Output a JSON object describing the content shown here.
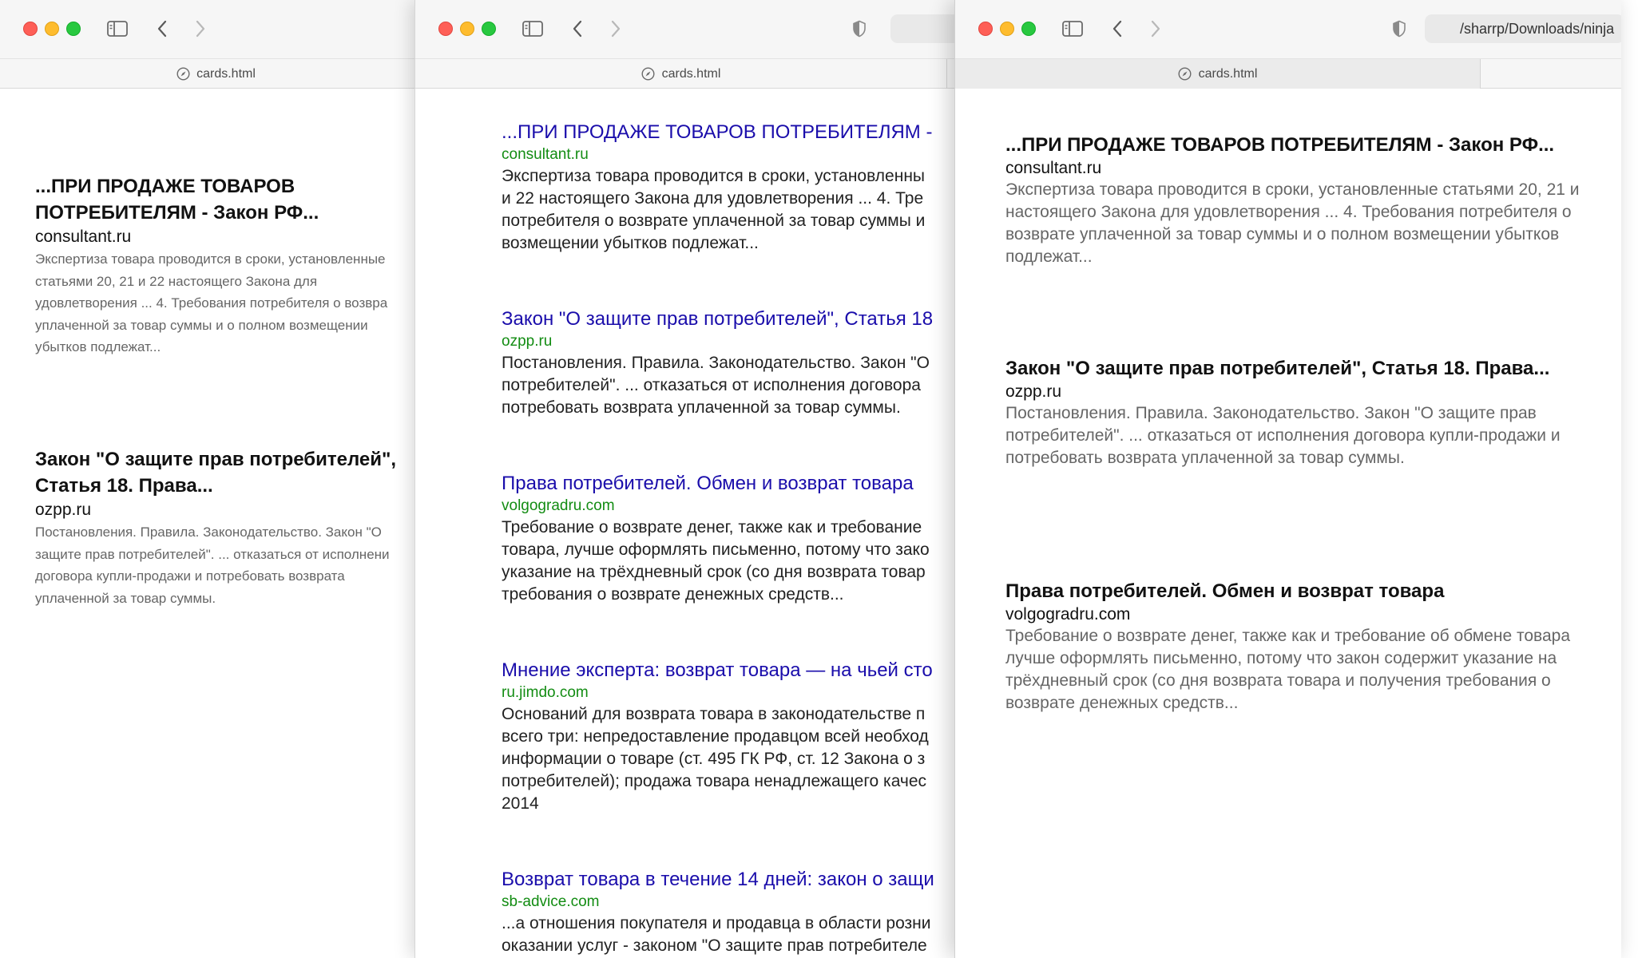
{
  "windows": [
    {
      "tab_label": "cards.html",
      "address": "",
      "cards": [
        {
          "title_lines": [
            "...ПРИ ПРОДАЖЕ ТОВАРОВ",
            "ПОТРЕБИТЕЛЯМ - Закон РФ..."
          ],
          "domain": "consultant.ru",
          "snippet_lines": [
            "Экспертиза товара проводится в сроки, установленные",
            "статьями 20, 21 и 22 настоящего Закона для",
            "удовлетворения ... 4. Требования потребителя о возвра",
            "уплаченной за товар суммы и о полном возмещении",
            "убытков подлежат..."
          ]
        },
        {
          "title_lines": [
            "Закон \"О защите прав потребителей\",",
            "Статья 18. Права..."
          ],
          "domain": "ozpp.ru",
          "snippet_lines": [
            "Постановления. Правила. Законодательство. Закон \"О",
            "защите прав потребителей\". ... отказаться от исполнени",
            "договора купли-продажи и потребовать возврата",
            "уплаченной за товар суммы."
          ]
        }
      ]
    },
    {
      "tab_label": "cards.html",
      "address": "",
      "cards": [
        {
          "title_lines": [
            "...ПРИ ПРОДАЖЕ ТОВАРОВ ПОТРЕБИТЕЛЯМ -"
          ],
          "domain": "consultant.ru",
          "snippet_lines": [
            "Экспертиза товара проводится в сроки, установленны",
            "и 22 настоящего Закона для удовлетворения ... 4. Тре",
            "потребителя о возврате уплаченной за товар суммы и",
            "возмещении убытков подлежат..."
          ]
        },
        {
          "title_lines": [
            "Закон \"О защите прав потребителей\", Статья 18"
          ],
          "domain": "ozpp.ru",
          "snippet_lines": [
            "Постановления. Правила. Законодательство. Закон \"О",
            "потребителей\". ... отказаться от исполнения договора",
            "потребовать возврата уплаченной за товар суммы."
          ]
        },
        {
          "title_lines": [
            "Права потребителей. Обмен и возврат товара"
          ],
          "domain": "volgogradru.com",
          "snippet_lines": [
            "Требование о возврате денег, также как и требование",
            "товара, лучше оформлять письменно, потому что зако",
            "указание на трёхдневный срок (со дня возврата товар",
            "требования о возврате денежных средств..."
          ]
        },
        {
          "title_lines": [
            "Мнение эксперта: возврат товара — на чьей сто"
          ],
          "domain": "ru.jimdo.com",
          "snippet_lines": [
            "Оснований для возврата товара в законодательстве п",
            "всего три: непредоставление продавцом всей необход",
            "информации о товаре (ст. 495 ГК РФ, ст. 12 Закона о з",
            "потребителей); продажа товара ненадлежащего качес",
            "2014"
          ]
        },
        {
          "title_lines": [
            "Возврат товара в течение 14 дней: закон о защи"
          ],
          "domain": "sb-advice.com",
          "snippet_lines": [
            "...а отношения покупателя и продавца в области розни",
            "оказании услуг - законом \"О защите прав потребителе"
          ]
        }
      ]
    },
    {
      "tab_label": "cards.html",
      "address": "/sharrp/Downloads/ninja",
      "cards": [
        {
          "title_lines": [
            "...ПРИ ПРОДАЖЕ ТОВАРОВ ПОТРЕБИТЕЛЯМ - Закон РФ..."
          ],
          "domain": "consultant.ru",
          "snippet_lines": [
            "Экспертиза товара проводится в сроки, установленные статьями 20, 21 и",
            "настоящего Закона для удовлетворения ... 4. Требования потребителя о",
            "возврате уплаченной за товар суммы и о полном возмещении убытков",
            "подлежат..."
          ]
        },
        {
          "title_lines": [
            "Закон \"О защите прав потребителей\", Статья 18. Права..."
          ],
          "domain": "ozpp.ru",
          "snippet_lines": [
            "Постановления. Правила. Законодательство. Закон \"О защите прав",
            "потребителей\". ... отказаться от исполнения договора купли-продажи и",
            "потребовать возврата уплаченной за товар суммы."
          ]
        },
        {
          "title_lines": [
            "Права потребителей. Обмен и возврат товара"
          ],
          "domain": "volgogradru.com",
          "snippet_lines": [
            "Требование о возврате денег, также как и требование об обмене товара",
            "лучше оформлять письменно, потому что закон содержит указание на",
            "трёхдневный срок (со дня возврата товара и получения требования о",
            "возврате денежных средств..."
          ]
        }
      ]
    }
  ],
  "colors": {
    "close": "#fe5f57",
    "minimize": "#febc2e",
    "zoom": "#28c840",
    "link_blue": "#1a0dab",
    "domain_green": "#128c12"
  },
  "icons": {
    "sidebar": "sidebar-toggle-icon",
    "back": "chevron-left-icon",
    "forward": "chevron-right-icon",
    "shield": "privacy-shield-icon",
    "compass": "compass-icon"
  }
}
